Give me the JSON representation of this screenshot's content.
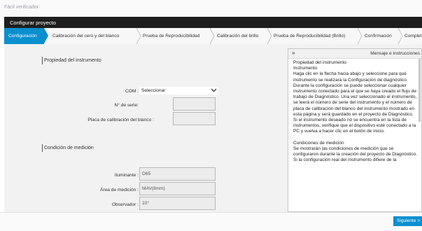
{
  "app": {
    "title": "Fácil verificador"
  },
  "header": {
    "title": "Configurar proyecto"
  },
  "tabs": [
    {
      "label": "Configuración",
      "active": true
    },
    {
      "label": "Calibración del cero y del blanco"
    },
    {
      "label": "Prueba de Reproducibilidad"
    },
    {
      "label": "Calibración del brillo"
    },
    {
      "label": "Prueba de Reproducibilidad (Brillo)"
    },
    {
      "label": "Confirmación"
    },
    {
      "label": "Complet"
    }
  ],
  "instrument": {
    "section_title": "Propiedad del instrumento",
    "com_label": "COM :",
    "com_value": "Seleccionar",
    "serial_label": "N° de serie:",
    "serial_value": "",
    "plate_label": "Placa de calibración del blanco :",
    "plate_value": ""
  },
  "measurement": {
    "section_title": "Condición de medición",
    "illuminant_label": "Iluminante :",
    "illuminant_value": "D65",
    "area_label": "Área de medición :",
    "area_value": "MAV(8mm)",
    "observer_label": "Observador :",
    "observer_value": "10°"
  },
  "panel": {
    "collapse_glyph": "»",
    "title": "Mensaje e instrucciones",
    "lines": [
      "Propiedad del instrumento",
      "Instrumento",
      "Haga clic en la flecha hacia abajo y seleccione para qué instrumento se realizará la Configuración de diagnóstico.",
      "Durante la configuración se puede seleccionar cualquier instrumento conectado para el que se haya creado el flujo de trabajo de Diagnóstico. Una vez seleccionado el instrumento, se leerá el número de serie del instrumento y el número de placa de calibración del blanco del instrumento mostrado en esta página y será guardado en el proyecto de Diagnóstico.",
      "Si el instrumento deseado no se encuentra en la lista de instrumentos, verifique que el dispositivo esté conectado a la PC y vuelva a hacer clic en el botón de inicio.",
      "",
      "Condiciones de medición",
      "Se mostrarán las condiciones de medición que se configuraron durante la creación del proyecto de Diagnóstico.",
      "Si la configuración real del instrumento difiere de la"
    ]
  },
  "footer": {
    "next_label": "Siguiente >"
  }
}
